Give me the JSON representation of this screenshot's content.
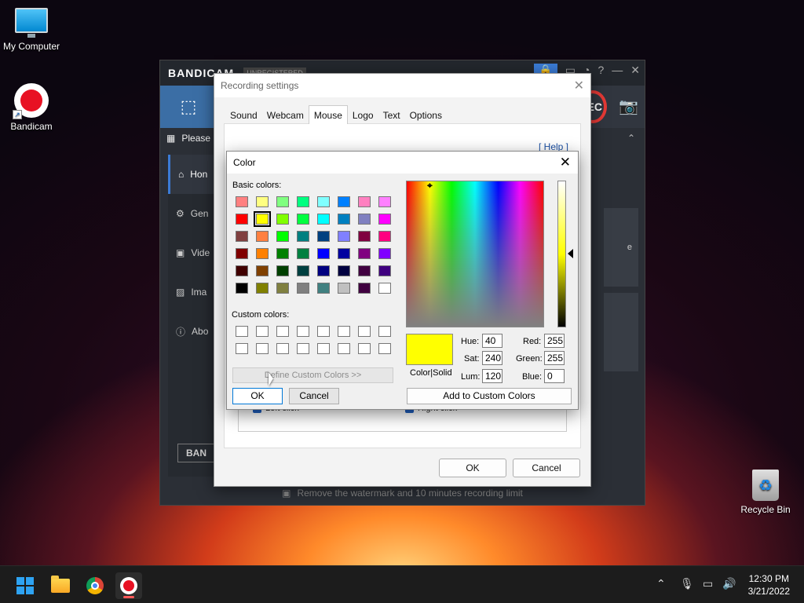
{
  "desktop": {
    "icons": [
      {
        "label": "My Computer"
      },
      {
        "label": "Bandicam"
      },
      {
        "label": "Recycle Bin"
      }
    ]
  },
  "bandicam": {
    "logo": "BANDICAM",
    "status": "UNREGISTERED",
    "rec_label": "REC",
    "banner_text": "Please",
    "sidebar": [
      {
        "label": "Hon",
        "icon": "home-icon"
      },
      {
        "label": "Gen",
        "icon": "gear-icon"
      },
      {
        "label": "Vide",
        "icon": "video-icon"
      },
      {
        "label": "Ima",
        "icon": "image-icon"
      },
      {
        "label": "Abo",
        "icon": "info-icon"
      }
    ],
    "bottom_logo": "BAN",
    "right_panel_text": "e",
    "footer": "Remove the watermark and 10 minutes recording limit"
  },
  "recording_settings": {
    "title": "Recording settings",
    "tabs": [
      "Sound",
      "Webcam",
      "Mouse",
      "Logo",
      "Text",
      "Options"
    ],
    "active_tab": "Mouse",
    "help": "[ Help ]",
    "left_click": "Left click",
    "right_click": "Right click",
    "ok": "OK",
    "cancel": "Cancel"
  },
  "color_dialog": {
    "title": "Color",
    "basic_colors_label": "Basic colors:",
    "custom_colors_label": "Custom colors:",
    "basic_colors": [
      [
        "#ff8080",
        "#ffff80",
        "#80ff80",
        "#00ff80",
        "#80ffff",
        "#0080ff",
        "#ff80c0",
        "#ff80ff"
      ],
      [
        "#ff0000",
        "#ffff00",
        "#80ff00",
        "#00ff40",
        "#00ffff",
        "#0080c0",
        "#8080c0",
        "#ff00ff"
      ],
      [
        "#804040",
        "#ff8040",
        "#00ff00",
        "#008080",
        "#004080",
        "#8080ff",
        "#800040",
        "#ff0080"
      ],
      [
        "#800000",
        "#ff8000",
        "#008000",
        "#008040",
        "#0000ff",
        "#0000a0",
        "#800080",
        "#8000ff"
      ],
      [
        "#400000",
        "#804000",
        "#004000",
        "#004040",
        "#000080",
        "#000040",
        "#400040",
        "#400080"
      ],
      [
        "#000000",
        "#808000",
        "#808040",
        "#808080",
        "#408080",
        "#c0c0c0",
        "#400040",
        "#ffffff"
      ]
    ],
    "selected_color": "#ffff00",
    "define_custom_colors": "Define Custom Colors >>",
    "ok": "OK",
    "cancel": "Cancel",
    "color_solid_label": "Color|Solid",
    "hue_label": "Hue:",
    "hue": "40",
    "sat_label": "Sat:",
    "sat": "240",
    "lum_label": "Lum:",
    "lum": "120",
    "red_label": "Red:",
    "red": "255",
    "green_label": "Green:",
    "green": "255",
    "blue_label": "Blue:",
    "blue": "0",
    "add_to_custom": "Add to Custom Colors"
  },
  "taskbar": {
    "time": "12:30 PM",
    "date": "3/21/2022"
  }
}
